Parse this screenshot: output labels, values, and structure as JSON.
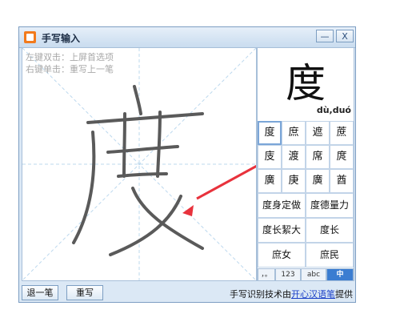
{
  "window": {
    "title": "手写输入",
    "minimize_label": "—",
    "close_label": "X"
  },
  "pad": {
    "hint_line1": "左键双击：上屏首选项",
    "hint_line2": "右键单击：重写上一笔"
  },
  "preview": {
    "character": "度",
    "pinyin": "dù,duó"
  },
  "candidates": [
    "度",
    "庶",
    "遮",
    "蔗",
    "庋",
    "渡",
    "席",
    "庹",
    "廣",
    "庚",
    "廣",
    "酋"
  ],
  "phrases": [
    "度身定做",
    "度德量力",
    "度长絜大",
    "度长",
    "庶女",
    "庶民"
  ],
  "mode_tabs": [
    "，。",
    "123",
    "abc",
    "中"
  ],
  "bottom": {
    "undo_label": "退一笔",
    "rewrite_label": "重写",
    "credit_text": "手写识别技术由",
    "credit_link": "开心汉语笔",
    "credit_tail": "提供"
  },
  "colors": {
    "arrow": "#e8323c",
    "active_tab": "#3b7dd1",
    "stroke": "#5a5a5a"
  }
}
